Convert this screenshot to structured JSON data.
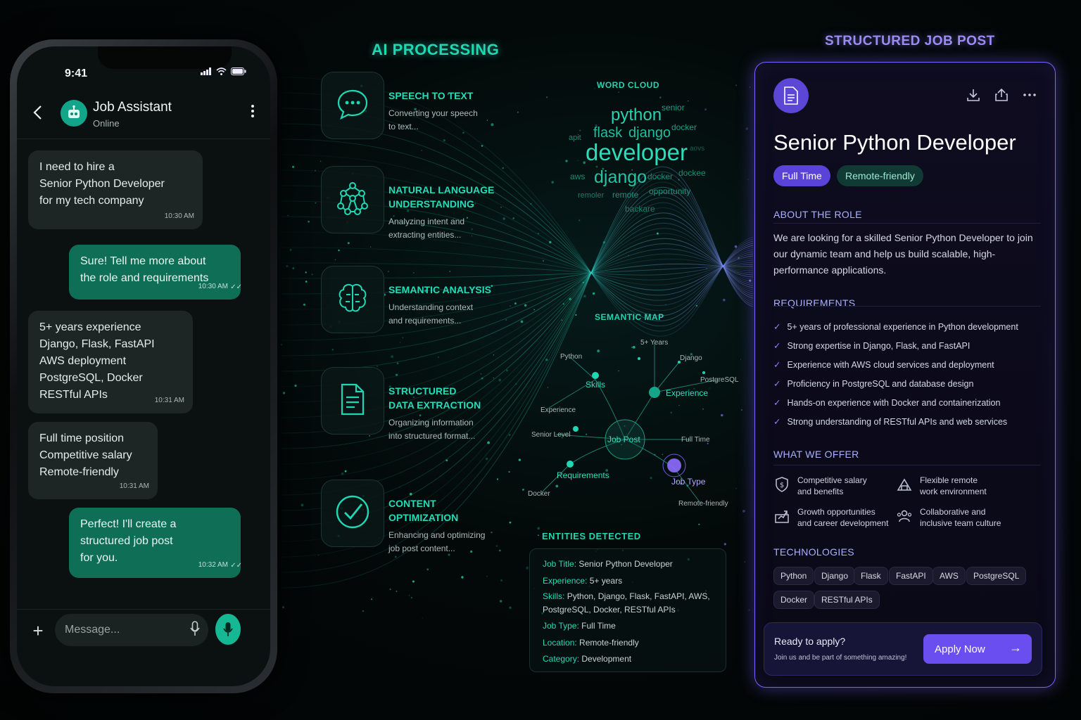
{
  "ai_title": "AI PROCESSING",
  "post_heading": "STRUCTURED JOB POST",
  "phone": {
    "status_time": "9:41",
    "chat_title": "Job Assistant",
    "chat_status": "Online",
    "composer_placeholder": "Message...",
    "messages": [
      {
        "text_lines": [
          "I need to hire a",
          "Senior Python Developer",
          "for my tech company"
        ],
        "time": "10:30 AM",
        "direction": "in"
      },
      {
        "text_lines": [
          "Sure! Tell me more about",
          "the role and requirements"
        ],
        "time": "10:30 AM",
        "direction": "out"
      },
      {
        "text_lines": [
          "5+ years experience",
          "Django, Flask, FastAPI",
          "AWS deployment",
          "PostgreSQL, Docker",
          "RESTful APIs"
        ],
        "time": "10:31 AM",
        "direction": "in"
      },
      {
        "text_lines": [
          "Full time position",
          "Competitive salary",
          "Remote-friendly"
        ],
        "time": "10:31 AM",
        "direction": "in"
      },
      {
        "text_lines": [
          "Perfect! I'll create a",
          "structured job post",
          "for you."
        ],
        "time": "10:32 AM",
        "direction": "out"
      }
    ]
  },
  "steps": [
    {
      "title_lines": [
        "SPEECH TO TEXT"
      ],
      "desc_lines": [
        "Converting your speech",
        "to text..."
      ],
      "icon": "chat-bubble-icon"
    },
    {
      "title_lines": [
        "NATURAL LANGUAGE",
        "UNDERSTANDING"
      ],
      "desc_lines": [
        "Analyzing intent and",
        "extracting entities..."
      ],
      "icon": "network-icon"
    },
    {
      "title_lines": [
        "SEMANTIC ANALYSIS"
      ],
      "desc_lines": [
        "Understanding context",
        "and requirements..."
      ],
      "icon": "brain-icon"
    },
    {
      "title_lines": [
        "STRUCTURED",
        "DATA EXTRACTION"
      ],
      "desc_lines": [
        "Organizing information",
        "into structured format..."
      ],
      "icon": "document-icon"
    },
    {
      "title_lines": [
        "CONTENT",
        "OPTIMIZATION"
      ],
      "desc_lines": [
        "Enhancing and optimizing",
        "job post content..."
      ],
      "icon": "check-circle-icon"
    }
  ],
  "word_cloud": {
    "title": "WORD CLOUD",
    "words": [
      "python",
      "senior",
      "flask",
      "django",
      "docker",
      "apit",
      "developer",
      "aws",
      "django",
      "docker",
      "dockee",
      "remoler",
      "remote",
      "opportunity",
      "backare",
      "aovs"
    ]
  },
  "semantic_map": {
    "title": "SEMANTIC MAP",
    "labels": [
      "Python",
      "5+ Years",
      "Django",
      "PostgreSQL",
      "Skills",
      "Experience",
      "Experience",
      "Senior Level",
      "Job Post",
      "Full Time",
      "Requirements",
      "Job Type",
      "Docker",
      "Remote-friendly"
    ]
  },
  "entities": {
    "title": "ENTITIES DETECTED",
    "rows": [
      {
        "key": "Job Title:",
        "value": "Senior Python Developer"
      },
      {
        "key": "Experience:",
        "value": "5+ years"
      },
      {
        "key": "Skills:",
        "value": "Python, Django, Flask, FastAPI, AWS, PostgreSQL, Docker, RESTful APIs"
      },
      {
        "key": "Job Type:",
        "value": "Full Time"
      },
      {
        "key": "Location:",
        "value": "Remote-friendly"
      },
      {
        "key": "Category:",
        "value": "Development"
      }
    ]
  },
  "post": {
    "title": "Senior Python Developer",
    "tags": [
      "Full Time",
      "Remote-friendly"
    ],
    "about_heading": "ABOUT THE ROLE",
    "about_text": "We are looking for a skilled Senior Python Developer to join our dynamic team and help us build scalable, high-performance applications.",
    "requirements_heading": "REQUIREMENTS",
    "requirements": [
      "5+ years of professional experience in Python development",
      "Strong expertise in Django, Flask, and FastAPI",
      "Experience with AWS cloud services and deployment",
      "Proficiency in PostgreSQL and database design",
      "Hands-on experience with Docker and containerization",
      "Strong understanding of RESTful APIs and web services"
    ],
    "offer_heading": "WHAT WE OFFER",
    "offers": [
      {
        "lines": [
          "Competitive salary",
          "and benefits"
        ],
        "icon": "shield-dollar-icon"
      },
      {
        "lines": [
          "Flexible remote",
          "work environment"
        ],
        "icon": "home-icon"
      },
      {
        "lines": [
          "Growth opportunities",
          "and career development"
        ],
        "icon": "growth-icon"
      },
      {
        "lines": [
          "Collaborative and",
          "inclusive team culture"
        ],
        "icon": "team-icon"
      }
    ],
    "tech_heading": "TECHNOLOGIES",
    "technologies": [
      "Python",
      "Django",
      "Flask",
      "FastAPI",
      "AWS",
      "PostgreSQL",
      "Docker",
      "RESTful APIs"
    ],
    "cta_heading": "Ready to apply?",
    "cta_sub": "Join us and be part of something amazing!",
    "apply_label": "Apply Now"
  },
  "colors": {
    "accent_teal": "#21d6b3",
    "accent_purple": "#7a63ff",
    "bubble_out": "#0f6e56"
  }
}
